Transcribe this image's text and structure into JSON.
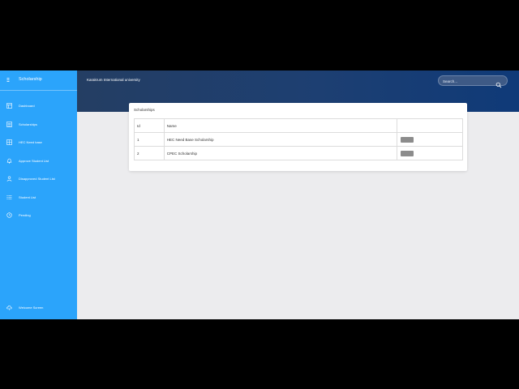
{
  "sidebar": {
    "brand": {
      "title": "Scholarship",
      "icon": "hamburger-icon"
    },
    "items": [
      {
        "label": "Dashboard",
        "icon": "dashboard-icon"
      },
      {
        "label": "Scholarships",
        "icon": "list-icon"
      },
      {
        "label": "HEC Need base",
        "icon": "table-icon"
      },
      {
        "label": "Approve Student List",
        "icon": "bell-icon"
      },
      {
        "label": "Disapproved Student List",
        "icon": "person-icon"
      },
      {
        "label": "Student List",
        "icon": "bullets-icon"
      },
      {
        "label": "Pending",
        "icon": "clock-icon"
      }
    ],
    "footer": {
      "label": "Welcome Screen",
      "icon": "cloud-icon"
    }
  },
  "header": {
    "company": "Karakrum International university",
    "search_placeholder": "Search..."
  },
  "card": {
    "title": "Scholarships",
    "columns": [
      "Id",
      "Name"
    ],
    "rows": [
      {
        "id": "1",
        "name": "HEC Need Base Scholarship"
      },
      {
        "id": "2",
        "name": "CPEC Scholarship"
      }
    ]
  },
  "colors": {
    "sidebar": "#2ba4fb",
    "header_gradient_start": "#243e63",
    "header_gradient_end": "#0f3a78",
    "content_bg": "#ececee",
    "action_button": "#8c8c8c"
  }
}
